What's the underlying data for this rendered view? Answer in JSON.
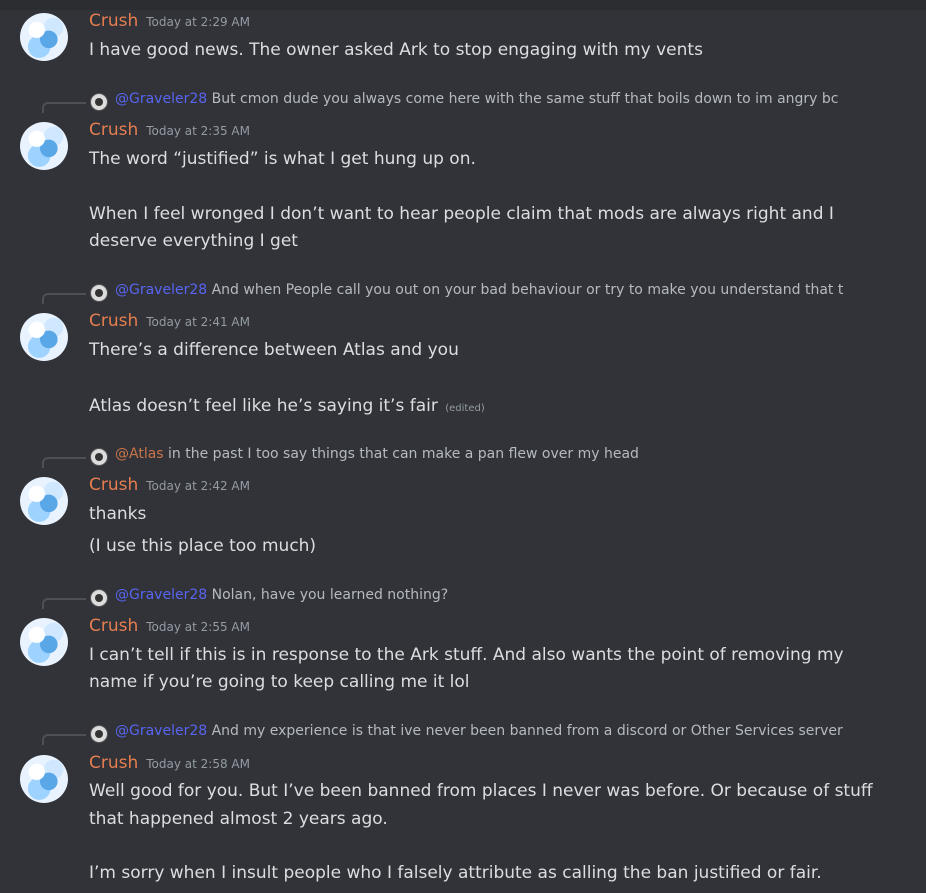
{
  "author": "Crush",
  "messages": [
    {
      "time": "Today at 2:29 AM",
      "lines": [
        "I have good news. The owner asked Ark to stop engaging with my vents"
      ]
    },
    {
      "reply": {
        "mention": "@Graveler28",
        "text": "But cmon dude you always come here with the same stuff that boils down to im angry bc"
      },
      "time": "Today at 2:35 AM",
      "lines": [
        "The word “justified” is what I get hung up on.",
        "When I feel wronged I don’t want to hear people claim that mods are always right and I",
        "deserve everything I get"
      ]
    },
    {
      "reply": {
        "mention": "@Graveler28",
        "text": "And when People call you out on your bad behaviour or try to make you understand that t"
      },
      "time": "Today at 2:41 AM",
      "lines": [
        "There’s a difference between Atlas and you",
        "Atlas doesn’t feel like he’s saying it’s fair"
      ],
      "edited": "(edited)"
    },
    {
      "reply": {
        "mention": "@Atlas",
        "text": "in the past I too say things that can make a pan flew over my head"
      },
      "time": "Today at 2:42 AM",
      "lines": [
        "thanks",
        "(I use this place too much)"
      ]
    },
    {
      "reply": {
        "mention": "@Graveler28",
        "text": "Nolan, have you learned nothing?"
      },
      "time": "Today at 2:55 AM",
      "lines": [
        "I can’t tell if this is in response to the Ark stuff. And also wants the point of removing my",
        "name if you’re going to keep calling me it lol"
      ]
    },
    {
      "reply": {
        "mention": "@Graveler28",
        "text": "And my experience is that ive never been banned from a discord or Other Services server"
      },
      "time": "Today at 2:58 AM",
      "lines": [
        "Well good for you. But I’ve been banned from places I never was before. Or because of stuff",
        "that happened almost 2 years ago.",
        " I’m sorry when I insult people who I falsely attribute as calling the ban justified or fair."
      ]
    }
  ],
  "colors": {
    "background": "#313338",
    "author": "#e67e50",
    "mention": "#5865f2",
    "mention_atlas": "#c9754a",
    "timestamp": "#949ba4",
    "text": "#dbdee1"
  }
}
